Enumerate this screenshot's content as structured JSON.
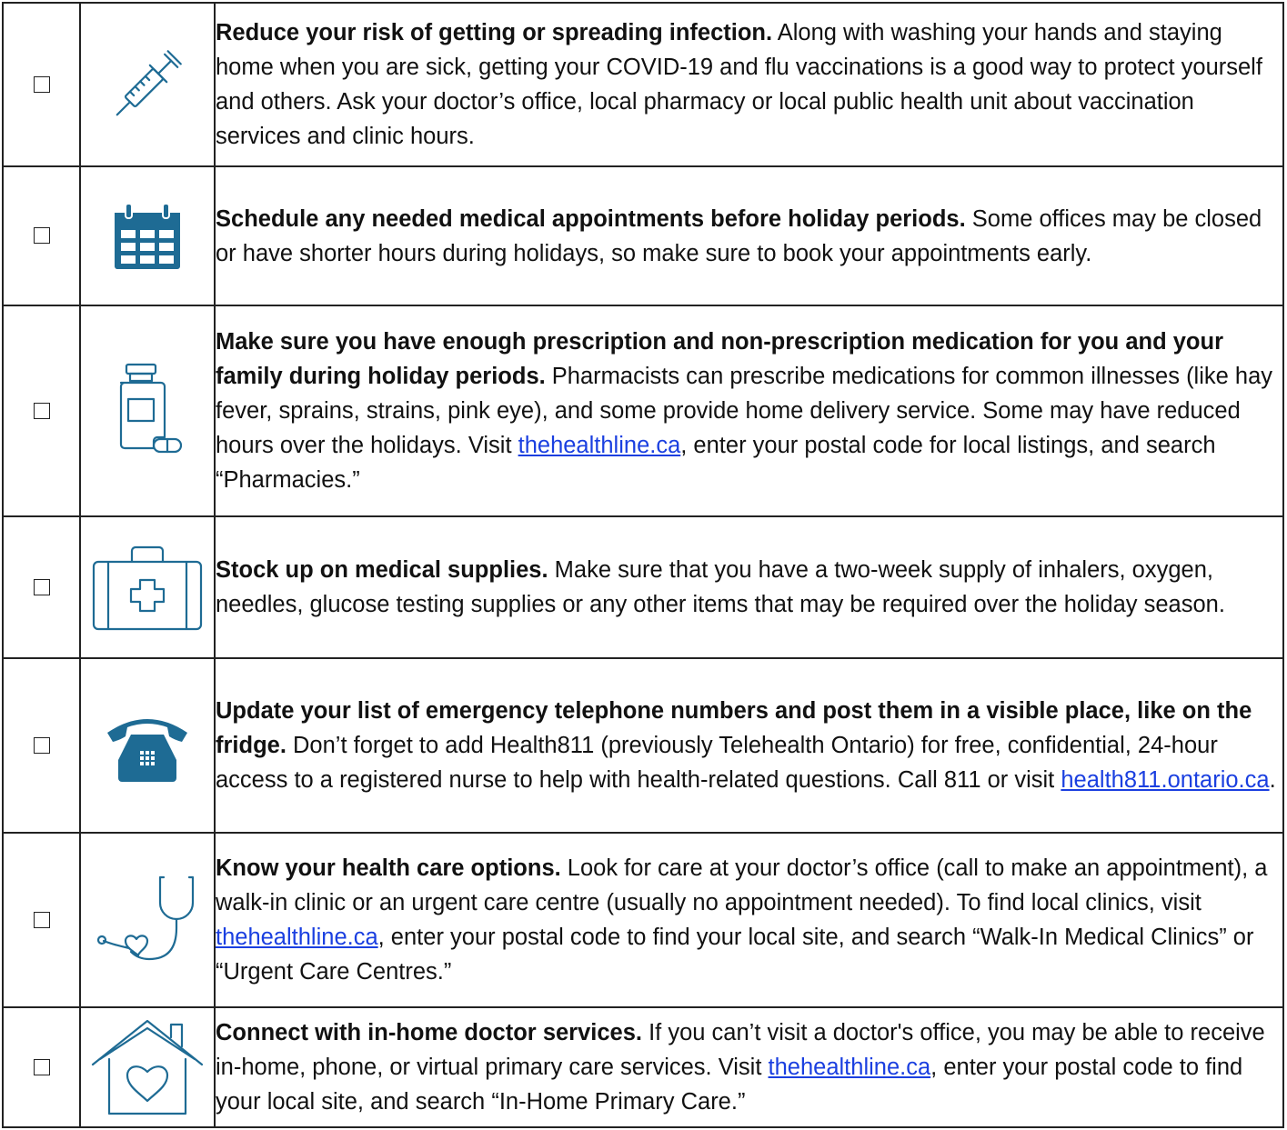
{
  "checkbox_symbol": "☐",
  "icon_color": "#1e6b94",
  "link_color": "#1a3fe0",
  "items": [
    {
      "icon": "syringe-icon",
      "lead": "Reduce your risk of getting or spreading infection.",
      "body": " Along with washing your hands and staying home when you are sick, getting your COVID-19 and flu vaccinations is a good way to protect yourself and others. Ask your doctor’s office, local pharmacy or local public health unit about vaccination services and clinic hours."
    },
    {
      "icon": "calendar-icon",
      "lead": "Schedule any needed medical appointments before holiday periods.",
      "body": " Some offices may be closed or have shorter hours during holidays, so make sure to book your appointments early."
    },
    {
      "icon": "medication-bottle-icon",
      "lead": "Make sure you have enough prescription and non-prescription medication for you and your family during holiday periods.",
      "body": " Pharmacists can prescribe medications for common illnesses (like hay fever, sprains, strains, pink eye), and some provide home delivery service. Some may have reduced hours over the holidays. Visit ",
      "link": "thehealthline.ca",
      "body_after": ", enter your postal code for local listings, and search “Pharmacies.”"
    },
    {
      "icon": "first-aid-kit-icon",
      "lead": "Stock up on medical supplies.",
      "body": " Make sure that you have a two-week supply of inhalers, oxygen, needles, glucose testing supplies or any other items that may be required over the holiday season."
    },
    {
      "icon": "telephone-icon",
      "lead": "Update your list of emergency telephone numbers and post them in a visible place, like on the fridge.",
      "body": " Don’t forget to add Health811 (previously Telehealth Ontario) for free, confidential, 24-hour access to a registered nurse to help with health-related questions. Call 811 or visit ",
      "link": "health811.ontario.ca",
      "body_after": "."
    },
    {
      "icon": "stethoscope-icon",
      "lead": "Know your health care options.",
      "body": " Look for care at your doctor’s office (call to make an appointment), a walk-in clinic or an urgent care centre (usually no appointment needed). To find local clinics, visit ",
      "link": "thehealthline.ca",
      "body_after": ", enter your postal code to find your local site, and search “Walk-In Medical Clinics” or “Urgent Care Centres.”"
    },
    {
      "icon": "house-heart-icon",
      "lead": "Connect with in-home doctor services.",
      "body": " If you can’t visit a doctor's office, you may be able to receive in-home, phone, or virtual primary care services. Visit ",
      "link": "thehealthline.ca",
      "body_after": ", enter your postal code to find your local site, and search “In-Home Primary Care.”"
    }
  ]
}
